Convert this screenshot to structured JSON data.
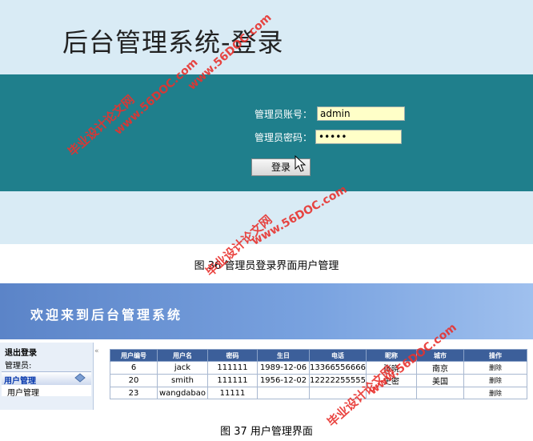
{
  "login": {
    "title": "后台管理系统-登录",
    "account_label": "管理员账号：",
    "account_value": "admin",
    "password_label": "管理员密码：",
    "password_value": "•••••",
    "login_button": "登录"
  },
  "captions": {
    "figure_36": "图 36 管理员登录界面用户管理",
    "figure_37": "图 37  用户管理界面"
  },
  "user_admin": {
    "header_title": "欢迎来到后台管理系统",
    "sidebar": {
      "logout": "退出登录",
      "admin_label": "管理员:",
      "section": "用户管理",
      "items": [
        "用户管理"
      ]
    },
    "collapse_glyph": "«",
    "table": {
      "columns": [
        "用户编号",
        "用户名",
        "密码",
        "生日",
        "电话",
        "昵称",
        "城市",
        "操作"
      ],
      "rows": [
        [
          "6",
          "jack",
          "111111",
          "1989-12-06",
          "13366556666",
          "张晓",
          "南京",
          "删除"
        ],
        [
          "20",
          "smith",
          "111111",
          "1956-12-02",
          "12222255555",
          "史密",
          "美国",
          "删除"
        ],
        [
          "23",
          "wangdabao",
          "11111",
          "",
          "",
          "",
          "",
          "删除"
        ]
      ]
    }
  },
  "watermarks": {
    "site_cn": "毕业设计论文网",
    "site_url": "www.56DOC.com",
    "color": "#e8322e"
  }
}
